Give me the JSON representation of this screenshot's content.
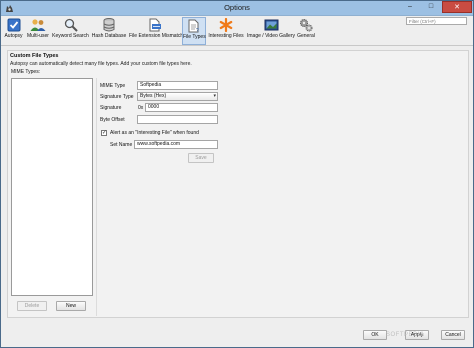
{
  "window": {
    "title": "Options",
    "minimize_glyph": "–",
    "maximize_glyph": "□",
    "close_glyph": "✕"
  },
  "toolbar": {
    "active_tab": "File Types",
    "tabs": [
      {
        "label": "Autopsy",
        "icon": "autopsy-check-icon"
      },
      {
        "label": "Multi-user",
        "icon": "users-icon"
      },
      {
        "label": "Keyword Search",
        "icon": "magnifier-icon"
      },
      {
        "label": "Hash Database",
        "icon": "database-icon"
      },
      {
        "label": "File Extension Mismatch",
        "icon": "file-mismatch-icon"
      },
      {
        "label": "File Types",
        "icon": "file-types-icon"
      },
      {
        "label": "Interesting Files",
        "icon": "asterisk-icon"
      },
      {
        "label": "Image / Video Gallery",
        "icon": "gallery-icon"
      },
      {
        "label": "General",
        "icon": "gears-icon"
      }
    ],
    "filter_placeholder": "Filter (Ctrl+F)"
  },
  "panel": {
    "title": "Custom File Types",
    "description": "Autopsy can automatically detect many file types. Add your custom file types here.",
    "mime_types_label": "MIME Types:",
    "delete_button": "Delete",
    "new_button": "New",
    "form": {
      "mime_type_label": "MIME Type",
      "mime_type_value": "Softpedia",
      "signature_type_label": "Signature Type",
      "signature_type_value": "Bytes (Hex)",
      "signature_label": "Signature",
      "signature_prefix": "0x",
      "signature_value": "0000",
      "byte_offset_label": "Byte Offset",
      "byte_offset_value": "",
      "alert_checkbox_label": "Alert as an \"Interesting File\" when found",
      "alert_checked": true,
      "set_name_label": "Set Name",
      "set_name_value": "www.softpedia.com",
      "save_button": "Save"
    }
  },
  "footer": {
    "ok_button": "OK",
    "apply_button": "Apply",
    "cancel_button": "Cancel",
    "watermark": "SOFTPEDIA"
  },
  "colors": {
    "titlebar": "#9cc0e3",
    "active_tab": "#cfe0f3",
    "close_button": "#c94c42"
  }
}
